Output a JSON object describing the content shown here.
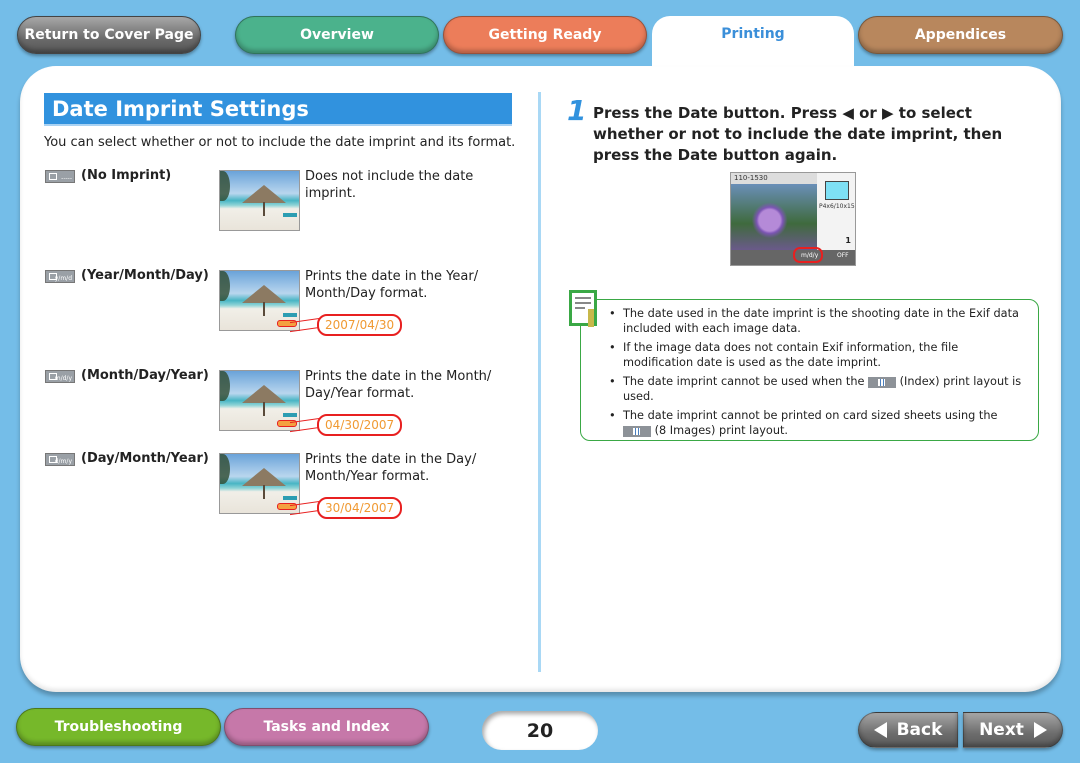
{
  "nav": {
    "cover_label": "Return to Cover Page",
    "tabs": [
      {
        "label": "Overview",
        "color": "#4bb28c"
      },
      {
        "label": "Getting Ready",
        "color": "#ec7d5a"
      },
      {
        "label": "Printing",
        "color": "#3b8fd9",
        "active": true
      },
      {
        "label": "Appendices",
        "color": "#b8875d"
      }
    ]
  },
  "left": {
    "title": "Date Imprint Settings",
    "intro": "You can select whether or not to include the date imprint and its format.",
    "settings": [
      {
        "icon_code": "-----",
        "label": "(No Imprint)",
        "description": "Does not include the date imprint.",
        "example": ""
      },
      {
        "icon_code": "y/m/d",
        "label": "(Year/Month/Day)",
        "description": "Prints the date in the Year/ Month/Day format.",
        "example": "2007/04/30"
      },
      {
        "icon_code": "m/d/y",
        "label": "(Month/Day/Year)",
        "description": "Prints the date in the Month/ Day/Year format.",
        "example": "04/30/2007"
      },
      {
        "icon_code": "d/m/y",
        "label": "(Day/Month/Year)",
        "description": "Prints the date in the Day/ Month/Year format.",
        "example": "30/04/2007"
      }
    ]
  },
  "right": {
    "step_number": "1",
    "step_text": "Press the Date button. Press ◀ or ▶ to select whether or not to include the date imprint, then press the Date button again.",
    "lcd": {
      "file_number": "110-1530",
      "paper_size": "P4x6/10x15",
      "copies": "1",
      "date_setting": "m/d/y",
      "correction": "OFF"
    },
    "notes": [
      "The date used in the date imprint is the shooting date in the Exif data included with each image data.",
      "If the image data does not contain Exif information, the file modification date is used as the date imprint.",
      {
        "before": "The date imprint cannot be used when the",
        "after": "(Index) print layout is used."
      },
      {
        "before": "The date imprint cannot be printed on card sized sheets using the",
        "after": "(8 Images) print layout."
      }
    ]
  },
  "footer": {
    "troubleshooting_label": "Troubleshooting",
    "tasks_label": "Tasks and Index",
    "page_number": "20",
    "back_label": "Back",
    "next_label": "Next"
  }
}
